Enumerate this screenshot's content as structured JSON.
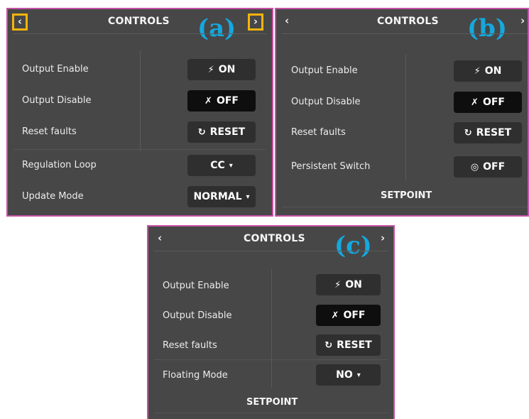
{
  "panel_a": {
    "tag": "(a)",
    "title": "CONTROLS",
    "prev_icon": "‹",
    "next_icon": "›",
    "rows": {
      "output_enable": {
        "label": "Output Enable",
        "button": "ON",
        "icon": "bolt-icon"
      },
      "output_disable": {
        "label": "Output Disable",
        "button": "OFF",
        "icon": "bolt-off-icon"
      },
      "reset_faults": {
        "label": "Reset faults",
        "button": "RESET",
        "icon": "reset-icon"
      },
      "regulation_loop": {
        "label": "Regulation Loop",
        "value": "CC"
      },
      "update_mode": {
        "label": "Update Mode",
        "value": "NORMAL"
      }
    }
  },
  "panel_b": {
    "tag": "(b)",
    "title": "CONTROLS",
    "prev_icon": "‹",
    "next_icon": "›",
    "rows": {
      "output_enable": {
        "label": "Output Enable",
        "button": "ON"
      },
      "output_disable": {
        "label": "Output Disable",
        "button": "OFF"
      },
      "reset_faults": {
        "label": "Reset faults",
        "button": "RESET"
      },
      "persistent_switch": {
        "label": "Persistent Switch",
        "button": "OFF",
        "icon": "toggle-icon"
      }
    },
    "section": "SETPOINT"
  },
  "panel_c": {
    "tag": "(c)",
    "title": "CONTROLS",
    "prev_icon": "‹",
    "next_icon": "›",
    "rows": {
      "output_enable": {
        "label": "Output Enable",
        "button": "ON"
      },
      "output_disable": {
        "label": "Output Disable",
        "button": "OFF"
      },
      "reset_faults": {
        "label": "Reset faults",
        "button": "RESET"
      },
      "floating_mode": {
        "label": "Floating Mode",
        "value": "NO"
      }
    },
    "section": "SETPOINT"
  },
  "icons": {
    "on": "⚡",
    "off": "✗",
    "reset": "↻",
    "toggle": "◎",
    "caret": "▾"
  },
  "colors": {
    "panel_bg": "#474747",
    "button_bg": "#2f2f2f",
    "button_active": "#0e0e0e",
    "frame": "#c552a4",
    "highlight": "#f6b40b",
    "tag": "#14a8df"
  }
}
